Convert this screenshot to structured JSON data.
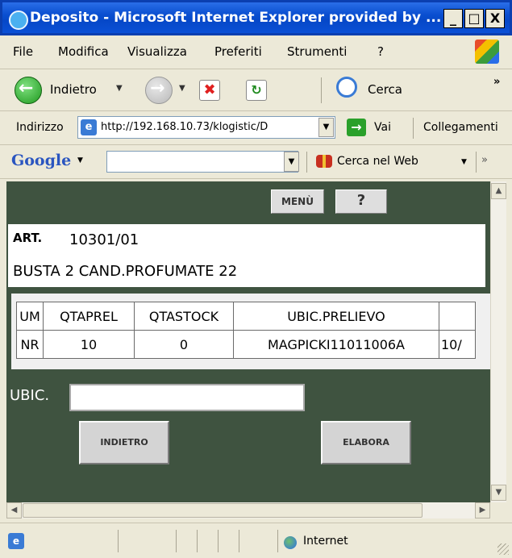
{
  "window": {
    "title": "Deposito - Microsoft Internet Explorer provided by ...",
    "controls": {
      "minimize": "_",
      "maximize": "□",
      "close": "X"
    }
  },
  "menubar": {
    "items": [
      "File",
      "Modifica",
      "Visualizza",
      "Preferiti",
      "Strumenti",
      "?"
    ]
  },
  "toolbar": {
    "back_label": "Indietro",
    "search_label": "Cerca",
    "overflow": "»"
  },
  "address": {
    "label": "Indirizzo",
    "url": "http://192.168.10.73/klogistic/D",
    "go_label": "Vai",
    "links_label": "Collegamenti"
  },
  "google": {
    "logo": "Google",
    "search_value": "",
    "search_web_label": "Cerca nel Web",
    "overflow": "»"
  },
  "page": {
    "menu_button": "MENÙ",
    "help_button": "?",
    "article": {
      "label": "ART.",
      "code": "10301/01",
      "description": "BUSTA 2 CAND.PROFUMATE 22"
    },
    "table": {
      "columns": [
        "UM",
        "QTAPREL",
        "QTASTOCK",
        "UBIC.PRELIEVO",
        ""
      ],
      "rows": [
        [
          "NR",
          "10",
          "0",
          "MAGPICKI11011006A",
          "10/"
        ]
      ]
    },
    "ubic_label": "UBIC.",
    "ubic_value": "",
    "back_button": "INDIETRO",
    "process_button": "ELABORA"
  },
  "statusbar": {
    "zone": "Internet"
  }
}
